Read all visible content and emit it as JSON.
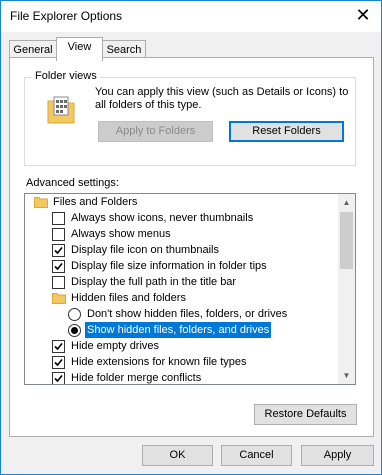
{
  "window": {
    "title": "File Explorer Options"
  },
  "tabs": [
    {
      "label": "General"
    },
    {
      "label": "View"
    },
    {
      "label": "Search"
    }
  ],
  "folder_views": {
    "label": "Folder views",
    "description": "You can apply this view (such as Details or Icons) to all folders of this type.",
    "apply_label": "Apply to Folders",
    "reset_label": "Reset Folders"
  },
  "advanced": {
    "label": "Advanced settings:",
    "items": [
      {
        "type": "folder",
        "label": "Files and Folders"
      },
      {
        "type": "checkbox",
        "label": "Always show icons, never thumbnails",
        "checked": false
      },
      {
        "type": "checkbox",
        "label": "Always show menus",
        "checked": false
      },
      {
        "type": "checkbox",
        "label": "Display file icon on thumbnails",
        "checked": true
      },
      {
        "type": "checkbox",
        "label": "Display file size information in folder tips",
        "checked": true
      },
      {
        "type": "checkbox",
        "label": "Display the full path in the title bar",
        "checked": false
      },
      {
        "type": "folder",
        "label": "Hidden files and folders"
      },
      {
        "type": "radio",
        "label": "Don't show hidden files, folders, or drives",
        "checked": false
      },
      {
        "type": "radio",
        "label": "Show hidden files, folders, and drives",
        "checked": true,
        "selected": true
      },
      {
        "type": "checkbox",
        "label": "Hide empty drives",
        "checked": true
      },
      {
        "type": "checkbox",
        "label": "Hide extensions for known file types",
        "checked": true
      },
      {
        "type": "checkbox",
        "label": "Hide folder merge conflicts",
        "checked": true
      }
    ]
  },
  "restore_label": "Restore Defaults",
  "footer": {
    "ok_label": "OK",
    "cancel_label": "Cancel",
    "apply_label": "Apply"
  },
  "colors": {
    "accent": "#0078d7",
    "folder": "#f4c860"
  }
}
